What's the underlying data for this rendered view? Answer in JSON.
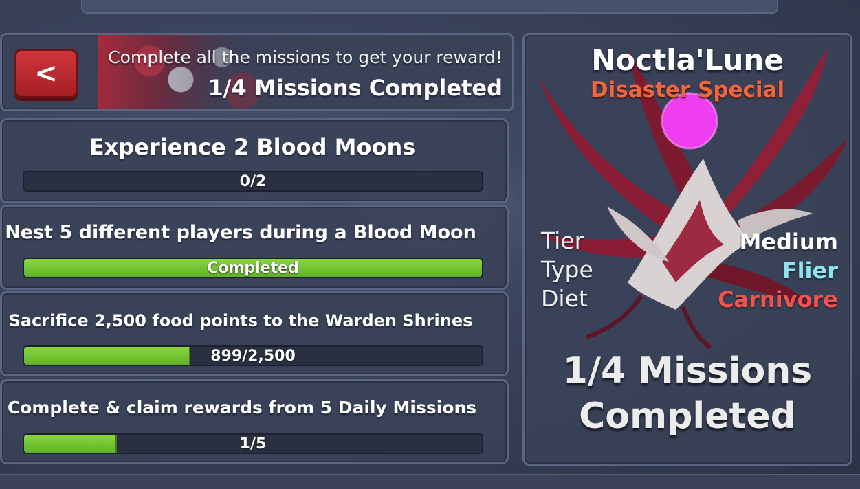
{
  "header": {
    "back_label": "<",
    "subtitle": "Complete all the missions to get your reward!",
    "progress_text": "1/4 Missions Completed"
  },
  "missions": [
    {
      "title": "Experience 2 Blood Moons",
      "progress_text": "0/2",
      "progress_fraction": 0.0
    },
    {
      "title": "Nest 5 different players during a Blood Moon",
      "progress_text": "Completed",
      "progress_fraction": 1.0
    },
    {
      "title": "Sacrifice 2,500 food points to the Warden Shrines",
      "progress_text": "899/2,500",
      "progress_fraction": 0.36
    },
    {
      "title": "Complete & claim rewards from 5 Daily Missions",
      "progress_text": "1/5",
      "progress_fraction": 0.2
    }
  ],
  "creature": {
    "name": "Noctla'Lune",
    "subtitle": "Disaster Special",
    "stats": [
      {
        "label": "Tier",
        "value": "Medium",
        "color": "#ffffff"
      },
      {
        "label": "Type",
        "value": "Flier",
        "color": "#8fe3ef"
      },
      {
        "label": "Diet",
        "value": "Carnivore",
        "color": "#f0524f"
      }
    ],
    "status_line1": "1/4 Missions",
    "status_line2": "Completed"
  },
  "colors": {
    "progress_green": "#7ccb36",
    "back_button_red": "#c22b33",
    "subtitle_orange": "#f2663f",
    "orb_magenta": "#ee3ef0"
  }
}
